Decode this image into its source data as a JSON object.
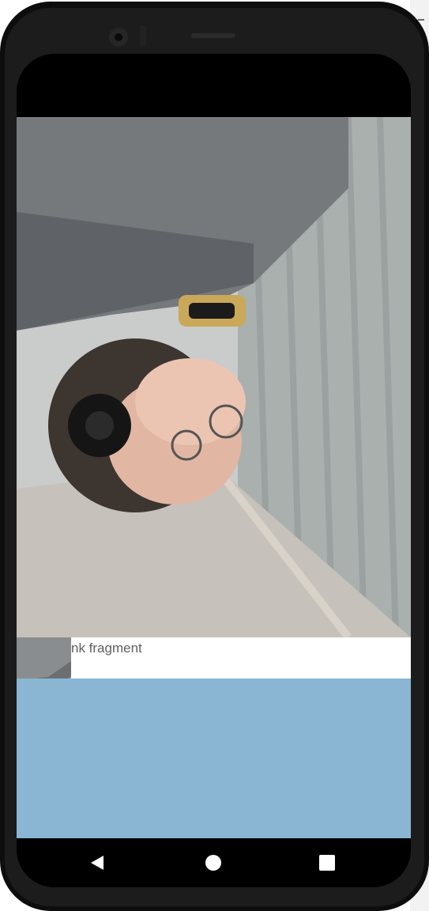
{
  "screen": {
    "label_text": "nk fragment"
  },
  "nav_bar": {
    "back_icon": "triangle-left-icon",
    "home_icon": "circle-icon",
    "recents_icon": "square-icon"
  },
  "colors": {
    "blank_area": "#8ab6d3",
    "status_bar": "#000000",
    "label_bar": "#ffffff",
    "label_text": "#5f5f5f"
  }
}
